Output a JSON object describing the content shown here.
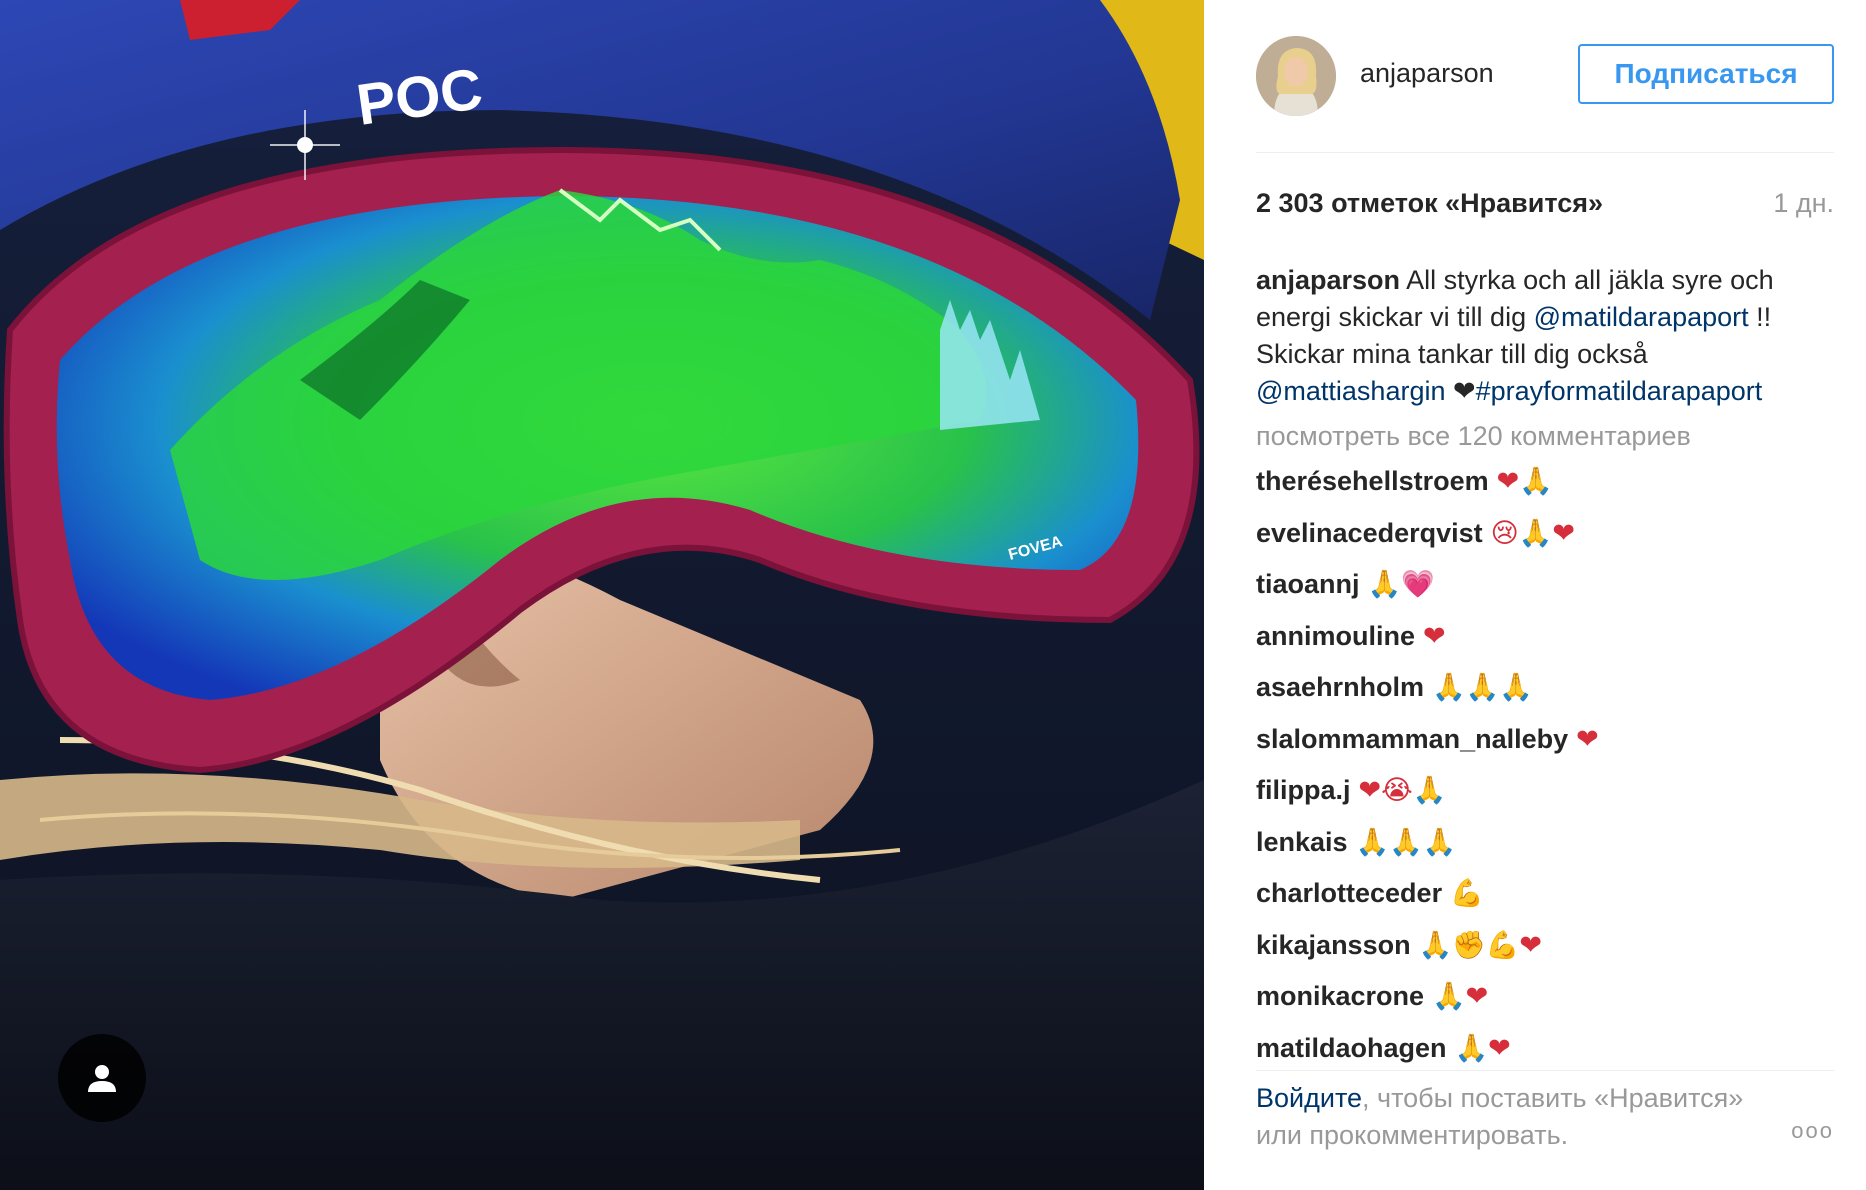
{
  "header": {
    "username": "anjaparson",
    "follow_label": "Подписаться"
  },
  "likes": {
    "count_text": "2 303 отметок «Нравится»",
    "timestamp": "1 дн."
  },
  "caption": {
    "username": "anjaparson",
    "text_1": "All styrka och all jäkla syre och energi skickar vi till dig",
    "mention_1": "@matildarapaport",
    "text_2": "!! Skickar mina tankar till dig också",
    "mention_2": "@mattiashargin",
    "text_3": "❤",
    "hashtag": "#prayformatildarapaport"
  },
  "view_all_comments": "посмотреть все 120 комментариев",
  "comments": [
    {
      "username": "therésehellstroem",
      "emoji": "❤🙏"
    },
    {
      "username": "evelinacederqvist",
      "emoji": "😢🙏❤"
    },
    {
      "username": "tiaoannj",
      "emoji": "🙏💗"
    },
    {
      "username": "annimouline",
      "emoji": "❤"
    },
    {
      "username": "asaehrnholm",
      "emoji": "🙏🙏🙏"
    },
    {
      "username": "slalommamman_nalleby",
      "emoji": "❤"
    },
    {
      "username": "filippa.j",
      "emoji": "❤😭🙏"
    },
    {
      "username": "lenkais",
      "emoji": "🙏🙏🙏"
    },
    {
      "username": "charlotteceder",
      "emoji": "💪"
    },
    {
      "username": "kikajansson",
      "emoji": "🙏✊💪❤"
    },
    {
      "username": "monikacrone",
      "emoji": "🙏❤"
    },
    {
      "username": "matildaohagen",
      "emoji": "🙏❤"
    }
  ],
  "footer": {
    "login_link": "Войдите",
    "login_rest": ", чтобы поставить «Нравится» или прокомментировать.",
    "more_label": "ooo"
  },
  "photo": {
    "helmet_brand": "POC",
    "lens_brand": "FOVEA",
    "icons": {
      "tag": "person-tag-icon",
      "more": "more-options-icon"
    },
    "colors": {
      "frame": "#a3204f",
      "lens_green": "#3fd13a",
      "lens_blue": "#1b4ad0",
      "helmet": "#2a3f9e"
    }
  }
}
